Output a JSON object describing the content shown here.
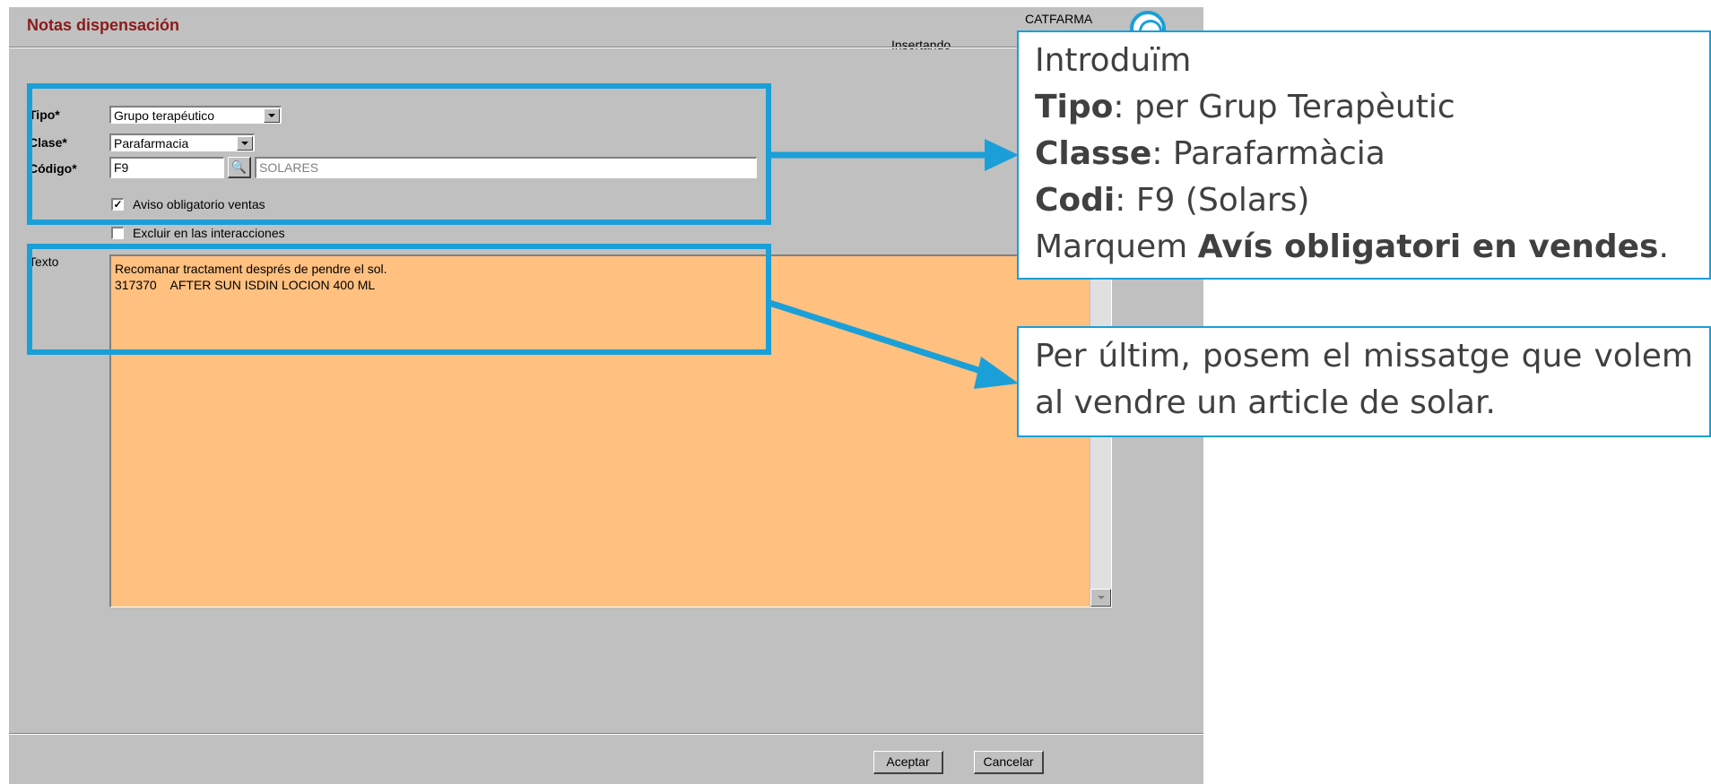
{
  "window": {
    "title": "Notas dispensación",
    "mode": "Insertando",
    "brand": "CATFARMA"
  },
  "form": {
    "tipo_label": "Tipo*",
    "tipo_value": "Grupo terapéutico",
    "clase_label": "Clase*",
    "clase_value": "Parafarmacia",
    "codigo_label": "Código*",
    "codigo_value": "F9",
    "codigo_desc": "SOLARES",
    "aviso_label": "Aviso obligatorio ventas",
    "aviso_checked": true,
    "excluir_label": "Excluir en las interacciones",
    "excluir_checked": false,
    "texto_label": "Texto",
    "texto_lines": [
      "Recomanar tractament després de pendre el sol.",
      "317370    AFTER SUN ISDIN LOCION 400 ML"
    ]
  },
  "buttons": {
    "accept": "Aceptar",
    "cancel": "Cancelar"
  },
  "callout1": {
    "line1": "Introduïm",
    "tipo_key": "Tipo",
    "tipo_rest": ": per Grup Terapèutic",
    "classe_key": "Classe",
    "classe_rest": ": Parafarmàcia",
    "codi_key": "Codi",
    "codi_rest": ": F9 (Solars)",
    "marquem": "Marquem ",
    "avis_key": "Avís obligatori en vendes",
    "avis_end": "."
  },
  "callout2": {
    "text": "Per últim, posem el missatge que volem al vendre un article de solar."
  },
  "colors": {
    "accent": "#1a9fd8",
    "title": "#8b1a1a",
    "textarea_bg": "#ffc080",
    "window_bg": "#c0c0c0"
  }
}
